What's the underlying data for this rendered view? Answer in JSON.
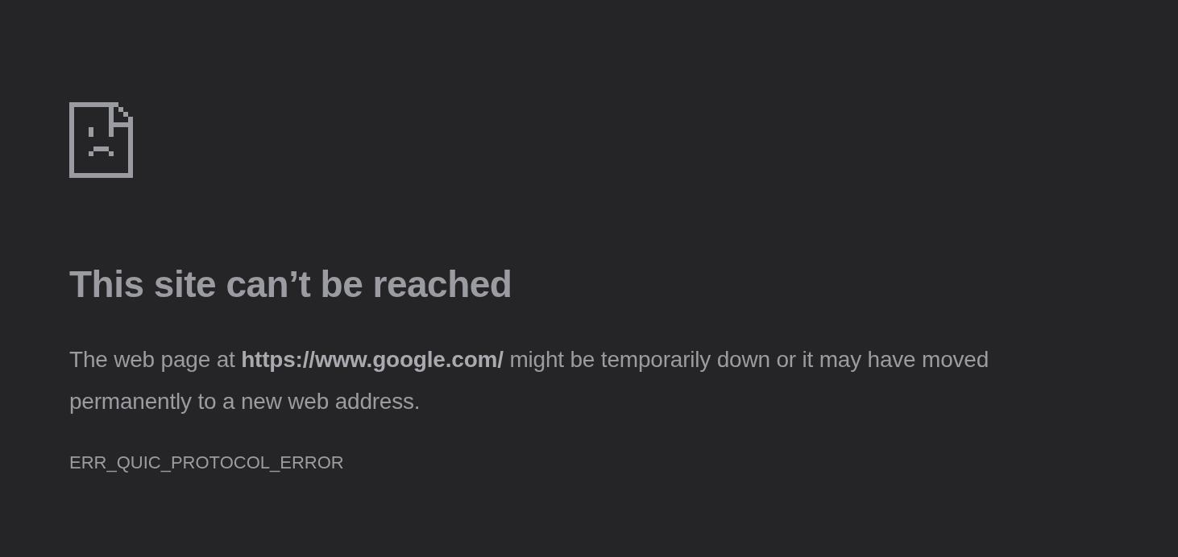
{
  "title": "This site can’t be reached",
  "message": "The web page at **https://www.google.com/** might be temporarily down or it may have moved permanently to a new web address.",
  "error_code": "ERR_QUIC_PROTOCOL_ERROR"
}
